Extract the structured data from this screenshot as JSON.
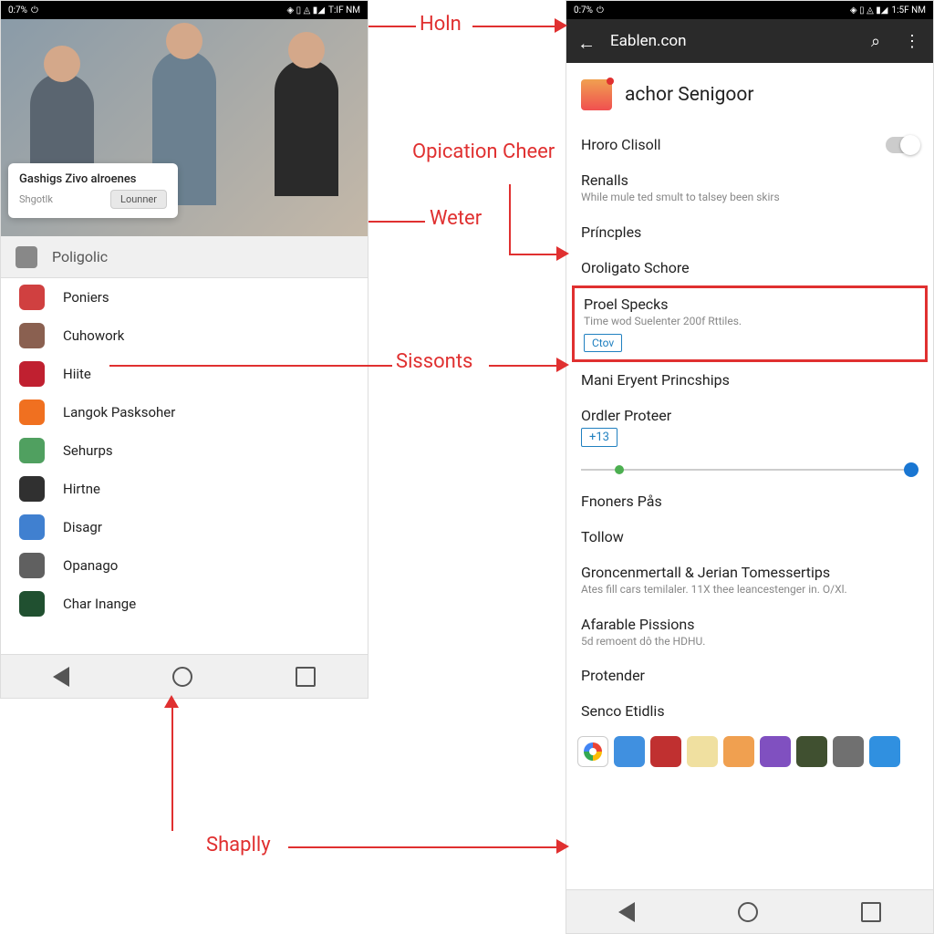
{
  "status": {
    "battery": "0:7%",
    "time": "T:IF NM",
    "time2": "1:5F NM"
  },
  "left": {
    "hero": {
      "title": "Gashigs Zivo alroenes",
      "sub": "Shgotlk",
      "btn": "Lounner"
    },
    "section": "Poligolic",
    "apps": [
      {
        "label": "Poniers",
        "color": "#d04040"
      },
      {
        "label": "Cuhowork",
        "color": "#8a6050"
      },
      {
        "label": "Hiite",
        "color": "#c02030"
      },
      {
        "label": "Langok Pasksoher",
        "color": "#f07020"
      },
      {
        "label": "Sehurps",
        "color": "#50a060"
      },
      {
        "label": "Hirtne",
        "color": "#303030"
      },
      {
        "label": "Disagr",
        "color": "#4080d0"
      },
      {
        "label": "Opanago",
        "color": "#606060"
      },
      {
        "label": "Char Inange",
        "color": "#205030"
      }
    ]
  },
  "right": {
    "toolbar": "Eablen.con",
    "header": "achor Senigoor",
    "rows": {
      "r1": "Hroro Clisoll",
      "r2": "Renalls",
      "r2s": "While mule ted smult to talsey been skirs",
      "r3": "Príncples",
      "r4": "Oroligato Schore",
      "hl_title": "Proel Specks",
      "hl_sub": "Time wod Suelenter 200f Rttiles.",
      "hl_chip": "Ctov",
      "r5": "Mani Eryent Princships",
      "r6": "Ordler Proteer",
      "r6_badge": "+13",
      "r7": "Fnoners Pås",
      "r8": "Tollow",
      "r9": "Groncenmertall & Jerian Tomessertips",
      "r9s": "Ates fill cars temilaler. 11X thee leancestenger in. O/Xl.",
      "r10": "Afarable Pissions",
      "r10s": "5d remoent dô the HDHU.",
      "r11": "Protender",
      "r12": "Senco Etidlis"
    },
    "dock_colors": [
      "#fff",
      "#4090e0",
      "#c03030",
      "#f0e0a0",
      "#f0a050",
      "#8050c0",
      "#405030",
      "#707070",
      "#3090e0"
    ]
  },
  "annotations": {
    "a1": "Holn",
    "a2": "Opication Cheer",
    "a3": "Weter",
    "a4": "Sissonts",
    "a5": "Shaplly"
  }
}
